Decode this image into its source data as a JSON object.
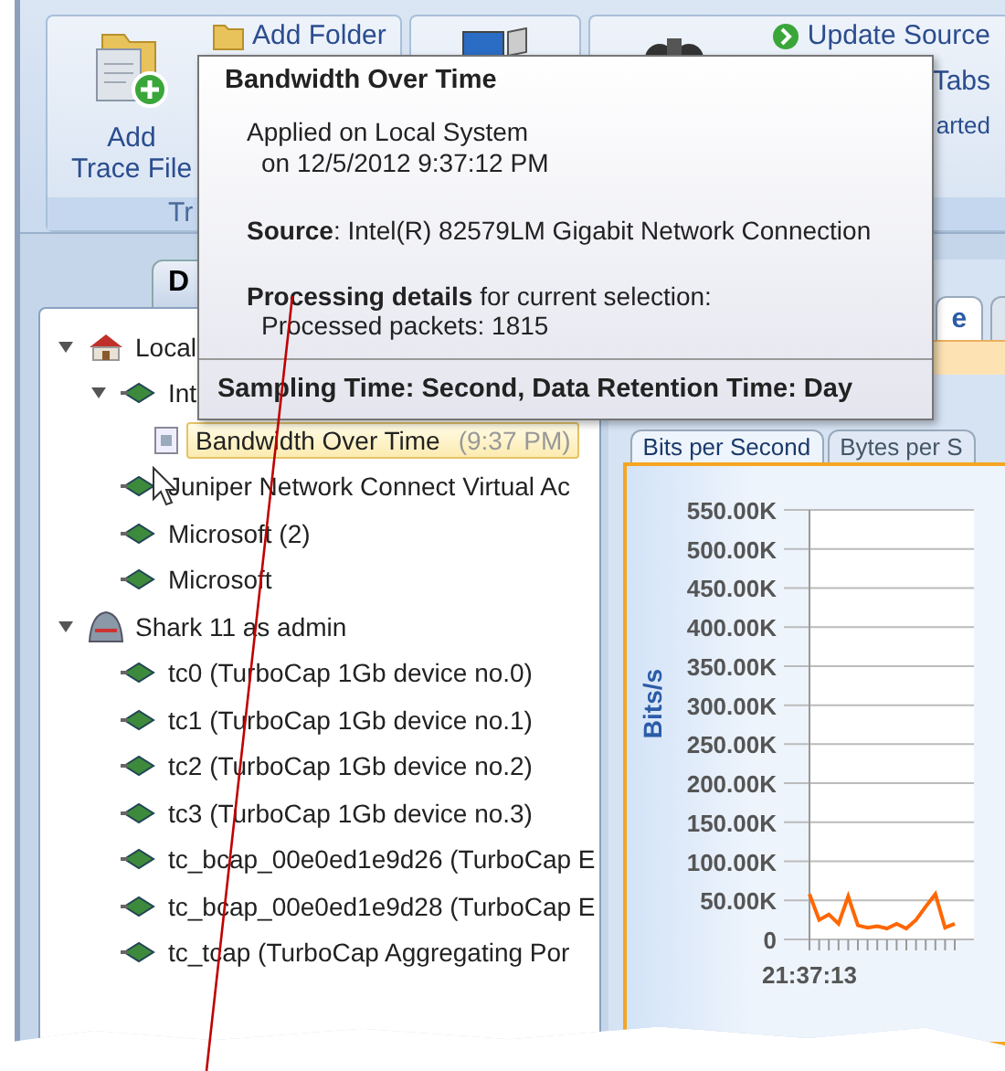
{
  "ribbon": {
    "groups": [
      {
        "label": "Tr",
        "buttons": [
          {
            "kind": "large",
            "label": "Add Trace File"
          },
          {
            "kind": "small",
            "label": "Add Folder"
          }
        ]
      },
      {
        "buttons": [
          {
            "kind": "large"
          }
        ]
      },
      {
        "buttons": [
          {
            "kind": "large"
          },
          {
            "kind": "small",
            "label": "Update Source"
          },
          {
            "kind": "small",
            "label": "Tabs"
          },
          {
            "kind": "small",
            "label": "arted"
          }
        ]
      }
    ]
  },
  "left_panel": {
    "tab": "D",
    "tree": [
      {
        "kind": "local",
        "label": "Local",
        "expanded": true,
        "selected": false,
        "children": [
          {
            "kind": "adapter",
            "label": "Int",
            "expanded": true,
            "selected": false,
            "children": [
              {
                "kind": "file",
                "label": "Bandwidth Over Time",
                "time": "(9:37 PM)",
                "selected": true
              }
            ]
          },
          {
            "kind": "adapter",
            "label": "Juniper Network Connect Virtual Ac",
            "selected": false
          },
          {
            "kind": "adapter",
            "label": "Microsoft (2)",
            "selected": false
          },
          {
            "kind": "adapter",
            "label": "Microsoft",
            "selected": false
          }
        ]
      },
      {
        "kind": "remote",
        "label": "Shark 11 as admin",
        "expanded": true,
        "selected": false,
        "children": [
          {
            "kind": "adapter",
            "label": "tc0 (TurboCap 1Gb device no.0)",
            "selected": false
          },
          {
            "kind": "adapter",
            "label": "tc1 (TurboCap 1Gb device no.1)",
            "selected": false
          },
          {
            "kind": "adapter",
            "label": "tc2 (TurboCap 1Gb device no.2)",
            "selected": false
          },
          {
            "kind": "adapter",
            "label": "tc3 (TurboCap 1Gb device no.3)",
            "selected": false
          },
          {
            "kind": "adapter",
            "label": "tc_bcap_00e0ed1e9d26 (TurboCap E",
            "selected": false
          },
          {
            "kind": "adapter",
            "label": "tc_bcap_00e0ed1e9d28 (TurboCap E",
            "selected": false
          },
          {
            "kind": "adapter",
            "label": "tc_tcap (TurboCap Aggregating Por",
            "selected": false
          }
        ]
      }
    ]
  },
  "right_panel": {
    "tabs": [
      {
        "label": "e",
        "selected": true
      },
      {
        "selected": false
      }
    ],
    "sub_tabs": [
      {
        "label": "Bits per Second",
        "selected": true
      },
      {
        "label": "Bytes per S",
        "selected": false
      }
    ],
    "x_axis_start": "21:37:13",
    "chart_data": {
      "type": "line",
      "ylabel": "Bits/s",
      "grid": true,
      "series": [
        {
          "color": "#ff6600",
          "values": [
            58000,
            25000,
            32000,
            20000,
            55000,
            18000,
            15000,
            17000,
            14000,
            20000,
            14000,
            25000,
            42000,
            58000,
            15000,
            20000
          ]
        }
      ],
      "ylim": [
        0,
        550000
      ],
      "yticks": [
        {
          "value": 0,
          "label": "0"
        },
        {
          "value": 50000,
          "label": "50.00K"
        },
        {
          "value": 100000,
          "label": "100.00K"
        },
        {
          "value": 150000,
          "label": "150.00K"
        },
        {
          "value": 200000,
          "label": "200.00K"
        },
        {
          "value": 250000,
          "label": "250.00K"
        },
        {
          "value": 300000,
          "label": "300.00K"
        },
        {
          "value": 350000,
          "label": "350.00K"
        },
        {
          "value": 400000,
          "label": "400.00K"
        },
        {
          "value": 450000,
          "label": "450.00K"
        },
        {
          "value": 500000,
          "label": "500.00K"
        },
        {
          "value": 550000,
          "label": "550.00K"
        }
      ]
    }
  },
  "tooltip": {
    "title": "Bandwidth Over Time",
    "lines": [
      "Applied on Local System",
      "on 12/5/2012 9:37:12 PM"
    ],
    "source": "**Source**: Intel(R) 82579LM Gigabit Network Connection",
    "details": "**Processing details** for current selection:",
    "packets": "Processed packets: 1815",
    "footer": "Sampling Time: Second, Data Retention Time: Day"
  }
}
